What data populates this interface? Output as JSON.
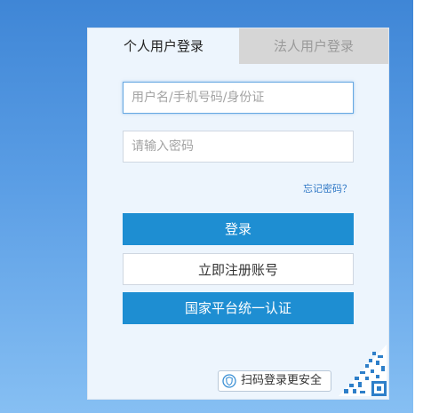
{
  "tabs": {
    "personal": "个人用户登录",
    "corporate": "法人用户登录"
  },
  "form": {
    "username_placeholder": "用户名/手机号码/身份证",
    "password_placeholder": "请输入密码",
    "forgot": "忘记密码？"
  },
  "buttons": {
    "login": "登录",
    "register": "立即注册账号",
    "auth": "国家平台统一认证"
  },
  "scan": {
    "label": "扫码登录更安全",
    "icon": "shield-icon",
    "qr_icon": "qr-code-icon"
  },
  "colors": {
    "primary": "#1e8ed2",
    "link": "#2e77c5",
    "panel": "#edf5fd",
    "inactive_tab": "#d6d6d6"
  }
}
